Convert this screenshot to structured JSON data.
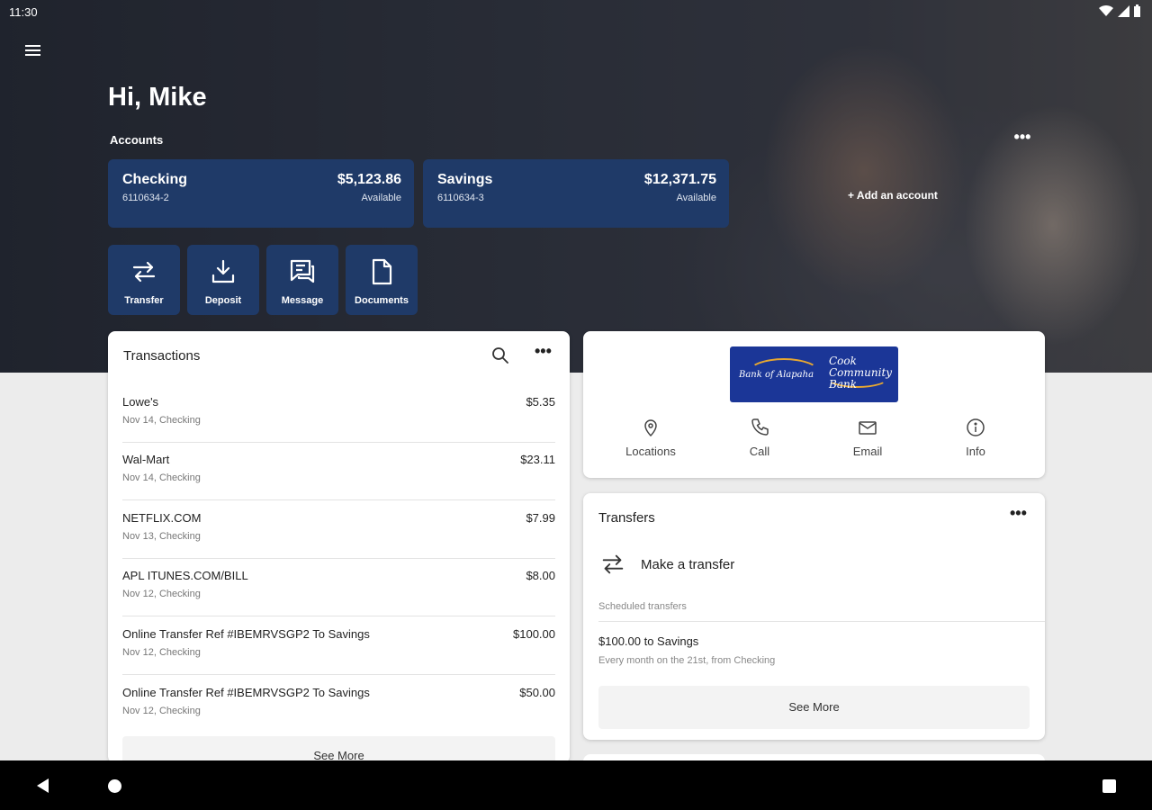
{
  "status": {
    "time": "11:30"
  },
  "header": {
    "greeting": "Hi, Mike",
    "accounts_label": "Accounts",
    "add_account": "+ Add an account"
  },
  "accounts": [
    {
      "name": "Checking",
      "number": "6110634-2",
      "balance": "$5,123.86",
      "balance_label": "Available"
    },
    {
      "name": "Savings",
      "number": "6110634-3",
      "balance": "$12,371.75",
      "balance_label": "Available"
    }
  ],
  "actions": [
    {
      "label": "Transfer",
      "icon": "transfer-icon"
    },
    {
      "label": "Deposit",
      "icon": "deposit-icon"
    },
    {
      "label": "Message",
      "icon": "message-icon"
    },
    {
      "label": "Documents",
      "icon": "document-icon"
    }
  ],
  "transactions": {
    "title": "Transactions",
    "items": [
      {
        "description": "Lowe's",
        "meta": "Nov 14, Checking",
        "amount": "$5.35"
      },
      {
        "description": "Wal-Mart",
        "meta": "Nov 14, Checking",
        "amount": "$23.11"
      },
      {
        "description": "NETFLIX.COM",
        "meta": "Nov 13, Checking",
        "amount": "$7.99"
      },
      {
        "description": "APL ITUNES.COM/BILL",
        "meta": "Nov 12, Checking",
        "amount": "$8.00"
      },
      {
        "description": "Online Transfer Ref #IBEMRVSGP2 To Savings",
        "meta": "Nov 12, Checking",
        "amount": "$100.00"
      },
      {
        "description": "Online Transfer Ref #IBEMRVSGP2 To Savings",
        "meta": "Nov 12, Checking",
        "amount": "$50.00"
      }
    ],
    "see_more": "See More"
  },
  "bank": {
    "logo_text_a": "Bank of Alapaha",
    "logo_text_b": "Cook Community Bank",
    "contacts": [
      {
        "label": "Locations",
        "icon": "location-pin-icon"
      },
      {
        "label": "Call",
        "icon": "phone-icon"
      },
      {
        "label": "Email",
        "icon": "email-icon"
      },
      {
        "label": "Info",
        "icon": "info-icon"
      }
    ]
  },
  "transfers": {
    "title": "Transfers",
    "make_transfer": "Make a transfer",
    "scheduled_label": "Scheduled transfers",
    "scheduled_item": "$100.00 to Savings",
    "scheduled_detail": "Every month on the 21st, from Checking",
    "see_more": "See More"
  },
  "colors": {
    "accent": "#1f3a68",
    "logo_bg": "#1b3697"
  }
}
